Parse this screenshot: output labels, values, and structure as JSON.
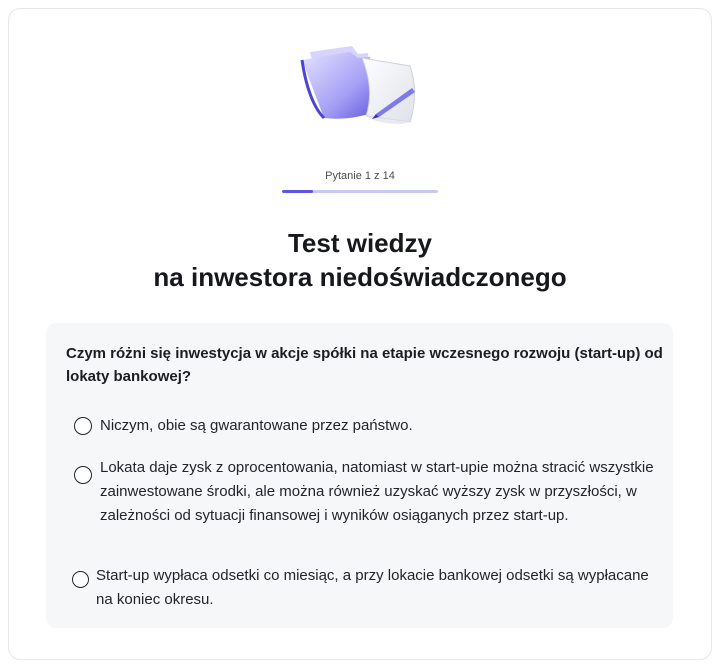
{
  "progress": {
    "label": "Pytanie 1 z 14",
    "fraction": 0.2
  },
  "title": {
    "line1": "Test wiedzy",
    "line2": "na inwestora niedoświadczonego"
  },
  "question": {
    "text": "Czym różni się inwestycja w akcje spółki na etapie wczesnego rozwoju (start-up) od lokaty bankowej?",
    "options": [
      {
        "label": "Niczym, obie są gwarantowane przez państwo.",
        "selected": false
      },
      {
        "label": "Lokata daje zysk z oprocentowania, natomiast w start-upie można stracić wszystkie zainwestowane środki, ale można również uzyskać wyższy zysk w przyszłości, w zależności od sytuacji finansowej i wyników osiąganych przez start-up.",
        "selected": false
      },
      {
        "label": "Start-up wypłaca odsetki co miesiąc, a przy lokacie bankowej odsetki są wypłacane na koniec okresu.",
        "selected": false
      }
    ]
  },
  "colors": {
    "accent": "#5b55e6",
    "track": "#c9c8f3",
    "question_bg": "#f6f7f9"
  },
  "icons": {
    "illustration": "folder-document-pen-icon"
  }
}
